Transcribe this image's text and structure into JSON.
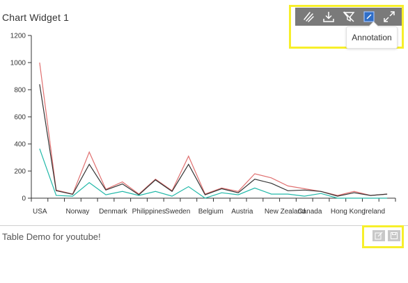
{
  "widget": {
    "title": "Chart Widget 1"
  },
  "toolbar": {
    "tools": [
      {
        "name": "draw-tool",
        "icon": "pen-icon"
      },
      {
        "name": "download-tool",
        "icon": "download-icon"
      },
      {
        "name": "clear-filter-tool",
        "icon": "filter-clear-icon"
      },
      {
        "name": "annotation-tool",
        "icon": "annotation-icon"
      },
      {
        "name": "fullscreen-tool",
        "icon": "expand-icon"
      }
    ],
    "tooltip": "Annotation"
  },
  "chart_data": {
    "type": "line",
    "categories": [
      "USA",
      "",
      "Norway",
      "",
      "Denmark",
      "",
      "Philippines",
      "",
      "Sweden",
      "",
      "Belgium",
      "",
      "Austria",
      "",
      "New Zealand",
      "",
      "Canada",
      "",
      "Hong Kong",
      "",
      "Ireland",
      ""
    ],
    "category_labels": [
      "USA",
      "Norway",
      "Denmark",
      "Philippines",
      "Sweden",
      "Belgium",
      "Austria",
      "New Zealand",
      "Canada",
      "Hong Kong",
      "Ireland"
    ],
    "ylim": [
      0,
      1200
    ],
    "yticks": [
      0,
      200,
      400,
      600,
      800,
      1000,
      1200
    ],
    "series": [
      {
        "color": "#e07070",
        "values": [
          1000,
          60,
          30,
          340,
          65,
          120,
          30,
          140,
          55,
          310,
          30,
          75,
          50,
          180,
          150,
          90,
          70,
          50,
          20,
          50,
          20,
          30
        ]
      },
      {
        "color": "#333333",
        "values": [
          840,
          55,
          28,
          250,
          60,
          105,
          25,
          135,
          50,
          250,
          25,
          70,
          40,
          140,
          110,
          55,
          60,
          50,
          15,
          40,
          20,
          30
        ]
      },
      {
        "color": "#20b8a8",
        "values": [
          365,
          20,
          15,
          115,
          25,
          50,
          20,
          50,
          15,
          85,
          0,
          40,
          25,
          75,
          30,
          30,
          15,
          35,
          0,
          0,
          0,
          0
        ]
      }
    ]
  },
  "table": {
    "title": "Table Demo for youtube!"
  }
}
